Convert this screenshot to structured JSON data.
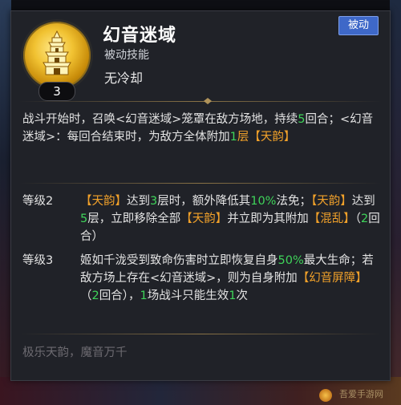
{
  "skill": {
    "name": "幻音迷域",
    "type": "被动技能",
    "cooldown": "无冷却",
    "level": "3",
    "tag": "被动",
    "icon": "golden-tower-icon"
  },
  "description": [
    {
      "t": "战斗开始时，召唤<幻音迷域>笼罩在敌方场地，持续",
      "c": ""
    },
    {
      "t": "5",
      "c": "green"
    },
    {
      "t": "回合；<幻音迷域>：每回合结束时，为敌方全体附加",
      "c": ""
    },
    {
      "t": "1",
      "c": "green"
    },
    {
      "t": "层【天韵】",
      "c": "orange"
    }
  ],
  "levels": [
    {
      "label": "等级2",
      "segments": [
        {
          "t": "【天韵】",
          "c": "orange"
        },
        {
          "t": "达到",
          "c": ""
        },
        {
          "t": "3",
          "c": "green"
        },
        {
          "t": "层时，额外降低其",
          "c": ""
        },
        {
          "t": "10%",
          "c": "green"
        },
        {
          "t": "法免；",
          "c": ""
        },
        {
          "t": "【天韵】",
          "c": "orange"
        },
        {
          "t": "达到",
          "c": ""
        },
        {
          "t": "5",
          "c": "green"
        },
        {
          "t": "层，立即移除全部",
          "c": ""
        },
        {
          "t": "【天韵】",
          "c": "orange"
        },
        {
          "t": "并立即为其附加",
          "c": ""
        },
        {
          "t": "【混乱】",
          "c": "orange"
        },
        {
          "t": "（",
          "c": ""
        },
        {
          "t": "2",
          "c": "green"
        },
        {
          "t": "回合）",
          "c": ""
        }
      ]
    },
    {
      "label": "等级3",
      "segments": [
        {
          "t": "姬如千泷受到致命伤害时立即恢复自身",
          "c": ""
        },
        {
          "t": "50%",
          "c": "green"
        },
        {
          "t": "最大生命；若敌方场上存在<幻音迷域>，则为自身附加",
          "c": ""
        },
        {
          "t": "【幻音屏障】",
          "c": "orange"
        },
        {
          "t": "（",
          "c": ""
        },
        {
          "t": "2",
          "c": "green"
        },
        {
          "t": "回合），",
          "c": ""
        },
        {
          "t": "1",
          "c": "green"
        },
        {
          "t": "场战斗只能生效",
          "c": ""
        },
        {
          "t": "1",
          "c": "green"
        },
        {
          "t": "次",
          "c": ""
        }
      ]
    }
  ],
  "flavor": "极乐天韵，魔音万千",
  "watermark": "吾爱手游网",
  "colors": {
    "green": "#3fd45a",
    "orange": "#f1a12a",
    "tag_bg": "#3e68c8",
    "icon_gold": "#f1c232"
  }
}
